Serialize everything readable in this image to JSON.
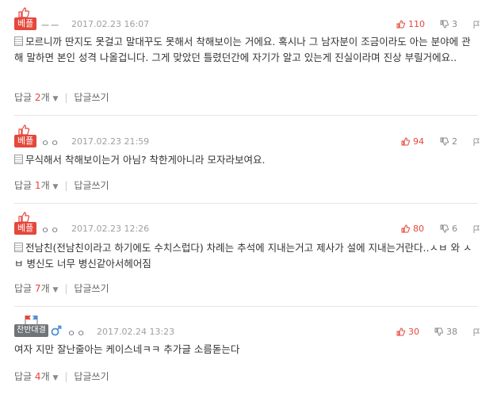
{
  "comments": [
    {
      "badge": "베플",
      "author": "ㅡㅡ",
      "date": "2017.02.23 16:07",
      "likes": "110",
      "dislikes": "3",
      "text": "모르니까 딴지도 못걸고 말대꾸도 못해서 착해보이는 거에요. 혹시나 그 남자분이 조금이라도 아는 분야에 관해 말하면 본인 성격 나올겁니다. 그게 맞았던 틀렸던간에 자기가 알고 있는게 진실이라며 진상 부릴거에요..",
      "reply_label": "답글",
      "reply_count": "2",
      "reply_unit": "개",
      "write_reply": "답글쓰기"
    },
    {
      "badge": "베플",
      "author": "ㅇㅇ",
      "date": "2017.02.23 21:59",
      "likes": "94",
      "dislikes": "2",
      "text": "무식해서 착해보이는거 아님? 착한게아니라 모자라보여요.",
      "reply_label": "답글",
      "reply_count": "1",
      "reply_unit": "개",
      "write_reply": "답글쓰기"
    },
    {
      "badge": "베플",
      "author": "ㅇㅇ",
      "date": "2017.02.23 12:26",
      "likes": "80",
      "dislikes": "6",
      "text": "전남친(전남친이라고 하기에도 수치스럽다) 차례는 추석에 지내는거고 제사가 설에 지내는거란다..ㅅㅂ 와 ㅅㅂ 병신도 너무 병신같아서헤어짐",
      "reply_label": "답글",
      "reply_count": "7",
      "reply_unit": "개",
      "write_reply": "답글쓰기"
    },
    {
      "badge": "찬반대결",
      "author": "ㅇㅇ",
      "date": "2017.02.24 13:23",
      "likes": "30",
      "dislikes": "38",
      "text": "여자 지만 잘난줄아는 케이스네ㅋㅋ 추가글 소름돋는다",
      "reply_label": "답글",
      "reply_count": "4",
      "reply_unit": "개",
      "write_reply": "답글쓰기"
    }
  ],
  "colors": {
    "accent": "#e5473b",
    "muted": "#a0a0a0",
    "badge_grey": "#6f7478",
    "gender_male": "#4a90d9"
  }
}
